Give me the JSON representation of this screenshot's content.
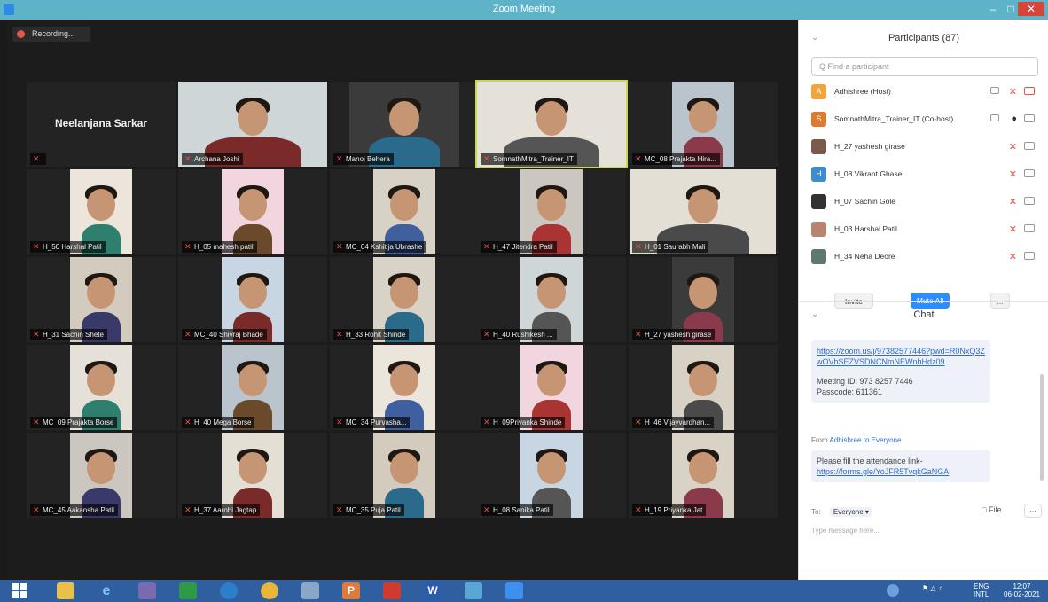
{
  "window": {
    "title": "Zoom Meeting"
  },
  "recording": {
    "label": "Recording..."
  },
  "gallery": {
    "tiles": [
      {
        "name": "Neelanjana Sarkar",
        "type": "name-only"
      },
      {
        "name": "Archana Joshi"
      },
      {
        "name": "Manoj Behera"
      },
      {
        "name": "SomnathMitra_Trainer_IT",
        "active": true
      },
      {
        "name": "MC_08 Prajakta Hira..."
      },
      {
        "name": "H_50 Harshal Patil"
      },
      {
        "name": "H_05 mahesh patil"
      },
      {
        "name": "MC_04 Kshitija Ubrashe"
      },
      {
        "name": "H_47 Jitendra Patil"
      },
      {
        "name": "H_01 Saurabh Mali"
      },
      {
        "name": "H_31 Sachin Shete"
      },
      {
        "name": "MC_40 Shivraj Bhade"
      },
      {
        "name": "H_33 Rohit Shinde"
      },
      {
        "name": "H_40 Rushikesh ..."
      },
      {
        "name": "H_27 yashesh girase"
      },
      {
        "name": "MC_09 Prajakta Borse"
      },
      {
        "name": "H_40 Mega Borse"
      },
      {
        "name": "MC_34 Purvasha..."
      },
      {
        "name": "H_09Priyanka Shinde"
      },
      {
        "name": "H_46 Vijayvardhan..."
      },
      {
        "name": "MC_45 Aakansha Patil"
      },
      {
        "name": "H_37 Aarohi Jagtap"
      },
      {
        "name": "MC_35 Puja Patil"
      },
      {
        "name": "H_08 Sanika Patil"
      },
      {
        "name": "H_19 Priyanka Jat"
      }
    ]
  },
  "participants": {
    "title": "Participants (87)",
    "search_placeholder": "Q Find a participant",
    "list": [
      {
        "initial": "A",
        "name": "Adhishree (Host)",
        "color": "#f2a43a"
      },
      {
        "initial": "S",
        "name": "SomnathMitra_Trainer_IT (Co-host)",
        "color": "#e07a2e"
      },
      {
        "initial": "",
        "name": "H_27 yashesh girase",
        "color": "#7a5a4a"
      },
      {
        "initial": "H",
        "name": "H_08 Vikrant Ghase",
        "color": "#3b8fcf"
      },
      {
        "initial": "",
        "name": "H_07 Sachin Gole",
        "color": "#333333"
      },
      {
        "initial": "",
        "name": "H_03 Harshal Patil",
        "color": "#b88370"
      },
      {
        "initial": "",
        "name": "H_34 Neha Deore",
        "color": "#5b7a6b"
      }
    ],
    "invite_label": "Invite",
    "mute_all_label": "Mute All",
    "more_label": "..."
  },
  "chat": {
    "title": "Chat",
    "message1_link": "https://zoom.us/j/97382577446?pwd=R0NxQ3ZwOVhSEZVSDNCNmNEWnhHdz09",
    "message1_meeting_id": "Meeting ID: 973 8257 7446",
    "message1_passcode": "Passcode: 611361",
    "from_prefix": "From",
    "from_sender": "Adhishree",
    "from_to": "to Everyone",
    "message2_text": "Please fill the attendance link-",
    "message2_link": "https://forms.gle/YoJFR5TvqkGaNGA",
    "to_label": "To:",
    "to_value": "Everyone",
    "file_label": "File",
    "more_label": "...",
    "input_placeholder": "Type message here..."
  },
  "taskbar": {
    "lang": "ENG",
    "region": "INTL",
    "time": "12:07",
    "date": "06-02-2021"
  },
  "colors": {
    "accent": "#2d8cff",
    "active_speaker": "#c9d94a",
    "titlebar": "#5fb3c9",
    "taskbar": "#2f5f9e"
  }
}
